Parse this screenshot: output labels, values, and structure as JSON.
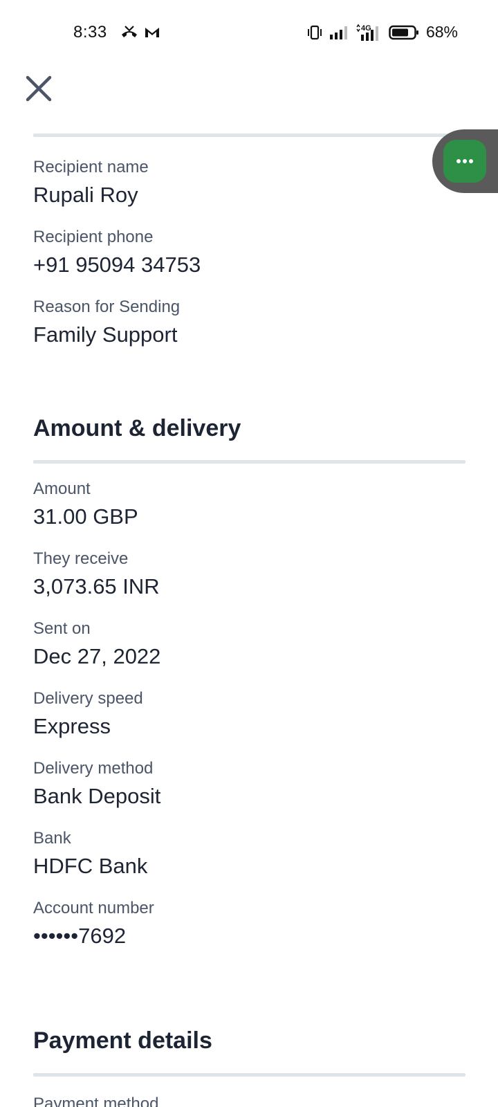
{
  "status_bar": {
    "time": "8:33",
    "battery_percent": "68%",
    "network": "4G",
    "notification_icons": [
      "missed-call-icon",
      "gmail-icon"
    ]
  },
  "header": {
    "close_icon": "close-icon"
  },
  "recipient": {
    "fields": [
      {
        "label": "Recipient name",
        "value": "Rupali Roy"
      },
      {
        "label": "Recipient phone",
        "value": "+91 95094 34753"
      },
      {
        "label": "Reason for Sending",
        "value": "Family Support"
      }
    ]
  },
  "amount_delivery": {
    "title": "Amount & delivery",
    "fields": [
      {
        "label": "Amount",
        "value": "31.00 GBP"
      },
      {
        "label": "They receive",
        "value": "3,073.65 INR"
      },
      {
        "label": "Sent on",
        "value": "Dec 27, 2022"
      },
      {
        "label": "Delivery speed",
        "value": "Express"
      },
      {
        "label": "Delivery method",
        "value": "Bank Deposit"
      },
      {
        "label": "Bank",
        "value": "HDFC Bank"
      },
      {
        "label": "Account number",
        "value": "••••••7692"
      }
    ]
  },
  "payment": {
    "title": "Payment details",
    "first_field_label": "Payment method"
  },
  "colors": {
    "chat_green": "#2e9046",
    "divider": "#dfe3ea",
    "text_dark": "#1d2433",
    "label_gray": "#4a5567"
  }
}
